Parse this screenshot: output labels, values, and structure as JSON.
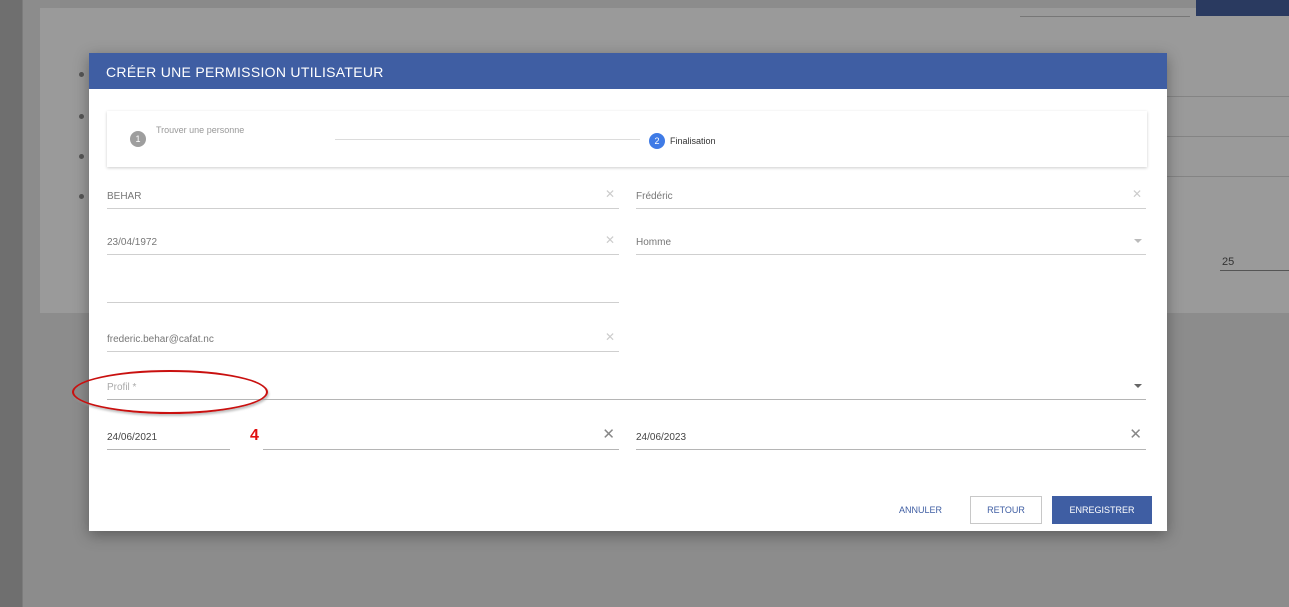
{
  "background": {
    "subtitle": "",
    "pagination_label": "",
    "pagination_value": "25"
  },
  "dialog": {
    "title": "CRÉER UNE PERMISSION UTILISATEUR",
    "stepper": {
      "step1_number": "1",
      "step1_label": "Trouver une personne",
      "step1_sublabel": "",
      "step2_number": "2",
      "step2_label": "Finalisation"
    },
    "fields": {
      "nom": "BEHAR",
      "prenom": "Frédéric",
      "date_naissance": "23/04/1972",
      "date_hint": "",
      "sexe": "Homme",
      "telephone_placeholder": "",
      "email": "frederic.behar@cafat.nc",
      "profil_placeholder": "Profil *",
      "date_debut": "24/06/2021",
      "date_fin": "24/06/2023"
    },
    "buttons": {
      "cancel": "ANNULER",
      "back": "RETOUR",
      "save": "ENREGISTRER"
    }
  },
  "annotation": {
    "number": "4"
  },
  "colors": {
    "primary": "#3f5ea3",
    "step_active": "#3f7be6",
    "annotation_red": "#e01010"
  }
}
